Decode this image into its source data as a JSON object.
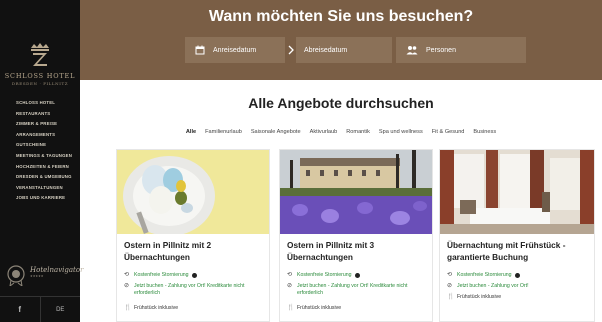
{
  "sidebar": {
    "logo_name": "SCHLOSS HOTEL",
    "logo_sub": "DRESDEN · PILLNITZ",
    "nav_items": [
      "SCHLOSS HOTEL",
      "RESTAURANTS",
      "ZIMMER & PREISE",
      "ARRANGEMENTS",
      "GUTSCHEINE",
      "MEETINGS & TAGUNGEN",
      "HOCHZEITEN & FEIERN",
      "DRESDEN & UMGEBUNG",
      "VERANSTALTUNGEN",
      "JOBS UND KARRIERE"
    ],
    "badge_text": "Hotelnavigator",
    "social": {
      "facebook": "f",
      "lang": "DE"
    }
  },
  "hero": {
    "title": "Wann möchten Sie uns besuchen?",
    "arrival": "Anreisedatum",
    "departure": "Abreisedatum",
    "persons": "Personen"
  },
  "main": {
    "title": "Alle Angebote durchsuchen",
    "tabs": [
      "Alle",
      "Familienurlaub",
      "Saisonale Angebote",
      "Aktivurlaub",
      "Romantik",
      "Spa und wellness",
      "Fit & Gesund",
      "Business"
    ],
    "active_tab": "Alle"
  },
  "cards": [
    {
      "title": "Ostern in Pillnitz mit 2 Übernachtungen",
      "cancel": "Kostenfreie Stornierung",
      "booking": "Jetzt buchen - Zahlung vor Ort! Kreditkarte nicht erforderlich",
      "breakfast": "Frühstück inklusive"
    },
    {
      "title": "Ostern in Pillnitz mit 3 Übernachtungen",
      "cancel": "Kostenfreie Stornierung",
      "booking": "Jetzt buchen - Zahlung vor Ort! Kreditkarte nicht erforderlich",
      "breakfast": "Frühstück inklusive"
    },
    {
      "title": "Übernachtung mit Frühstück - garantierte Buchung",
      "cancel": "Kostenfreie Stornierung",
      "booking": "Jetzt buchen - Zahlung vor Ort!",
      "breakfast": "Frühstück inklusive"
    }
  ],
  "colors": {
    "hero_bg": "#7a5e45",
    "field_bg": "#8b7158",
    "sidebar_bg": "#111111",
    "green": "#2a8a3a"
  }
}
